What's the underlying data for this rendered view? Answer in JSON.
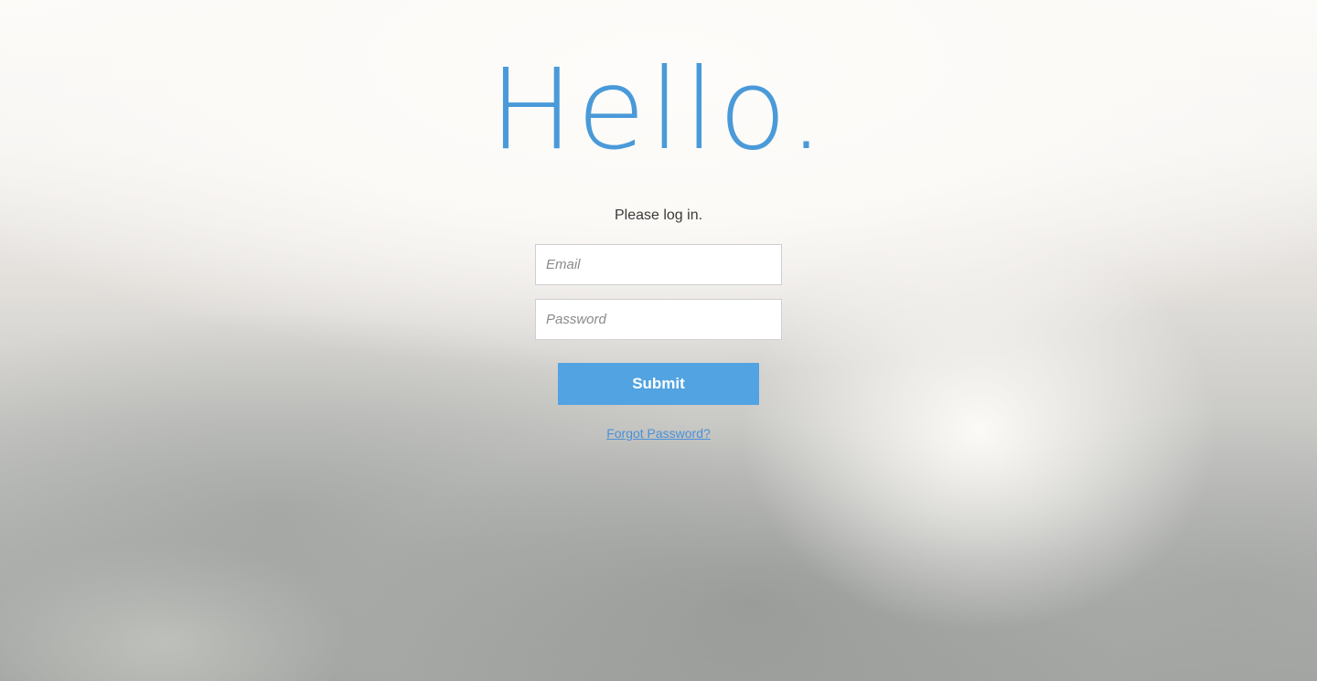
{
  "header": {
    "greeting": "Hello."
  },
  "login": {
    "prompt": "Please log in.",
    "email_placeholder": "Email",
    "email_value": "",
    "password_placeholder": "Password",
    "password_value": "",
    "submit_label": "Submit",
    "forgot_label": "Forgot Password?"
  },
  "colors": {
    "accent": "#4a9ad9",
    "button": "#52a3e1",
    "link": "#4a90d9"
  }
}
